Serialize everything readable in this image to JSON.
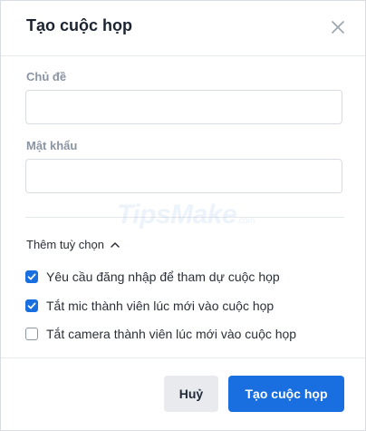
{
  "dialog": {
    "title": "Tạo cuộc họp",
    "close_icon": "close-icon"
  },
  "fields": {
    "topic": {
      "label": "Chủ đề",
      "value": "",
      "placeholder": ""
    },
    "password": {
      "label": "Mật khẩu",
      "value": "",
      "placeholder": ""
    }
  },
  "options_toggle": {
    "label": "Thêm tuỳ chọn",
    "icon": "chevron-up-icon"
  },
  "options": [
    {
      "label": "Yêu cầu đăng nhập để tham dự cuộc họp",
      "checked": true
    },
    {
      "label": "Tắt mic thành viên lúc mới vào cuộc họp",
      "checked": true
    },
    {
      "label": "Tắt camera thành viên lúc mới vào cuộc họp",
      "checked": false
    }
  ],
  "footer": {
    "cancel_label": "Huỷ",
    "create_label": "Tạo cuộc họp"
  },
  "watermark": {
    "text": "TipsMake",
    "suffix": ".com"
  },
  "colors": {
    "primary": "#1a6fe0",
    "cancel_bg": "#e8eaed",
    "label_gray": "#8a94a3",
    "border": "#d9dde3"
  }
}
